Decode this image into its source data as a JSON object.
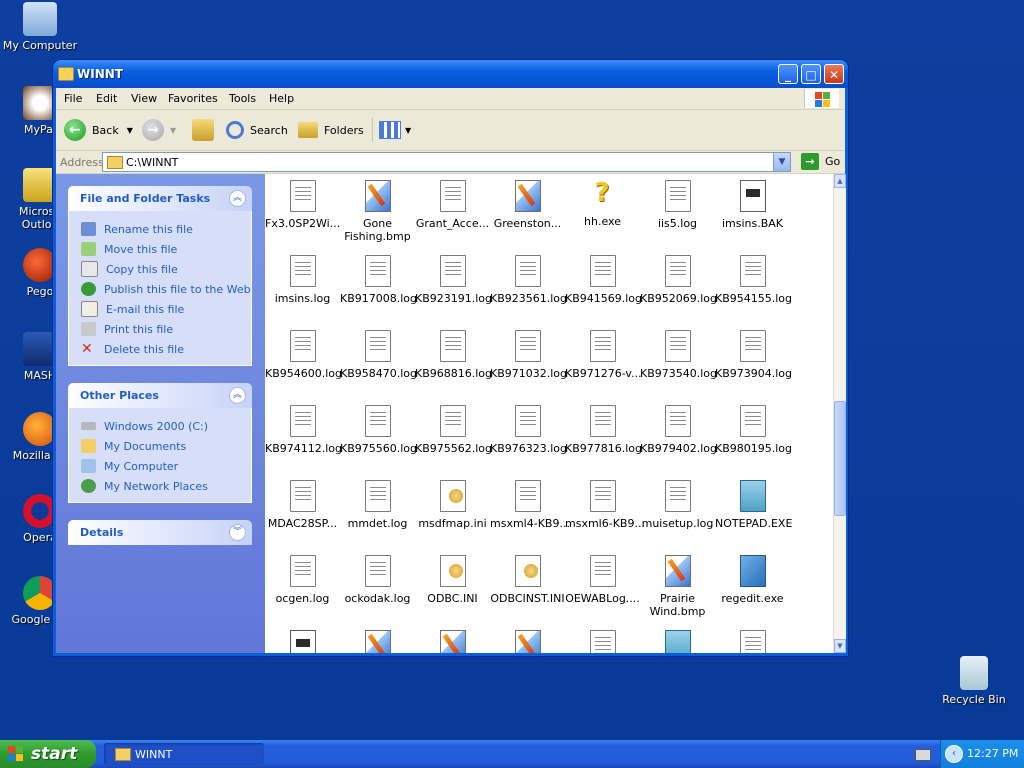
{
  "desktop": {
    "icons": [
      {
        "label": "My Computer"
      },
      {
        "label": "MyPal"
      },
      {
        "label": "Microso Outloo"
      },
      {
        "label": "Pego"
      },
      {
        "label": "MASH"
      },
      {
        "label": "Mozilla Fir"
      },
      {
        "label": "Opera"
      },
      {
        "label": "Google Ch"
      },
      {
        "label": "Recycle Bin"
      }
    ]
  },
  "window": {
    "title": "WINNT",
    "menu": [
      "File",
      "Edit",
      "View",
      "Favorites",
      "Tools",
      "Help"
    ],
    "toolbar": {
      "back": "Back",
      "search": "Search",
      "folders": "Folders"
    },
    "address": {
      "label": "Address",
      "value": "C:\\WINNT",
      "go": "Go"
    },
    "tasks_panel": {
      "title": "File and Folder Tasks",
      "items": [
        "Rename this file",
        "Move this file",
        "Copy this file",
        "Publish this file to the Web",
        "E-mail this file",
        "Print this file",
        "Delete this file"
      ]
    },
    "places_panel": {
      "title": "Other Places",
      "items": [
        "Windows 2000 (C:)",
        "My Documents",
        "My Computer",
        "My Network Places"
      ]
    },
    "details_panel": {
      "title": "Details"
    },
    "files": [
      {
        "name": "Fx3.0SP2Wi...",
        "icon": "txt"
      },
      {
        "name": "Gone\nFishing.bmp",
        "icon": "bmp"
      },
      {
        "name": "Grant_Acce...",
        "icon": "txt"
      },
      {
        "name": "Greenston...",
        "icon": "bmp"
      },
      {
        "name": "hh.exe",
        "icon": "help"
      },
      {
        "name": "iis5.log",
        "icon": "txt"
      },
      {
        "name": "imsins.BAK",
        "icon": "bak"
      },
      {
        "name": "imsins.log",
        "icon": "txt"
      },
      {
        "name": "KB917008.log",
        "icon": "txt"
      },
      {
        "name": "KB923191.log",
        "icon": "txt"
      },
      {
        "name": "KB923561.log",
        "icon": "txt"
      },
      {
        "name": "KB941569.log",
        "icon": "txt"
      },
      {
        "name": "KB952069.log",
        "icon": "txt"
      },
      {
        "name": "KB954155.log",
        "icon": "txt"
      },
      {
        "name": "KB954600.log",
        "icon": "txt"
      },
      {
        "name": "KB958470.log",
        "icon": "txt"
      },
      {
        "name": "KB968816.log",
        "icon": "txt"
      },
      {
        "name": "KB971032.log",
        "icon": "txt"
      },
      {
        "name": "KB971276-v...",
        "icon": "txt"
      },
      {
        "name": "KB973540.log",
        "icon": "txt"
      },
      {
        "name": "KB973904.log",
        "icon": "txt"
      },
      {
        "name": "KB974112.log",
        "icon": "txt"
      },
      {
        "name": "KB975560.log",
        "icon": "txt"
      },
      {
        "name": "KB975562.log",
        "icon": "txt"
      },
      {
        "name": "KB976323.log",
        "icon": "txt"
      },
      {
        "name": "KB977816.log",
        "icon": "txt"
      },
      {
        "name": "KB979402.log",
        "icon": "txt"
      },
      {
        "name": "KB980195.log",
        "icon": "txt"
      },
      {
        "name": "MDAC28SP...",
        "icon": "txt"
      },
      {
        "name": "mmdet.log",
        "icon": "txt"
      },
      {
        "name": "msdfmap.ini",
        "icon": "ini"
      },
      {
        "name": "msxml4-KB9...",
        "icon": "txt"
      },
      {
        "name": "msxml6-KB9...",
        "icon": "txt"
      },
      {
        "name": "muisetup.log",
        "icon": "txt"
      },
      {
        "name": "NOTEPAD.EXE",
        "icon": "exe"
      },
      {
        "name": "ocgen.log",
        "icon": "txt"
      },
      {
        "name": "ockodak.log",
        "icon": "txt"
      },
      {
        "name": "ODBC.INI",
        "icon": "ini"
      },
      {
        "name": "ODBCINST.INI",
        "icon": "ini"
      },
      {
        "name": "OEWABLog....",
        "icon": "txt"
      },
      {
        "name": "Prairie\nWind.bmp",
        "icon": "bmp"
      },
      {
        "name": "regedit.exe",
        "icon": "reg"
      },
      {
        "name": "",
        "icon": "bak"
      },
      {
        "name": "",
        "icon": "bmp"
      },
      {
        "name": "",
        "icon": "bmp"
      },
      {
        "name": "",
        "icon": "bmp"
      },
      {
        "name": "",
        "icon": "txt"
      },
      {
        "name": "",
        "icon": "exe"
      },
      {
        "name": "",
        "icon": "txt"
      }
    ]
  },
  "taskbar": {
    "start": "start",
    "task": "WINNT",
    "clock": "12:27 PM"
  }
}
